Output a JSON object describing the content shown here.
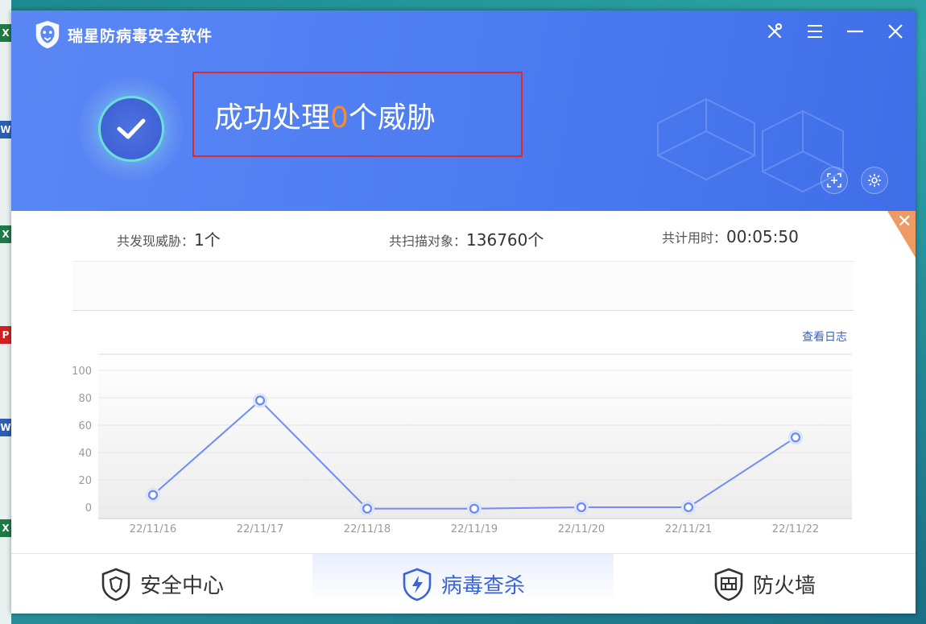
{
  "app": {
    "title": "瑞星防病毒安全软件"
  },
  "result": {
    "prefix": "成功处理",
    "count": "0",
    "suffix": "个威胁"
  },
  "stats": {
    "threats_label": "共发现威胁：",
    "threats_value": "1个",
    "objects_label": "共扫描对象：",
    "objects_value": "136760个",
    "time_label": "共计用时：",
    "time_value": "00:05:50"
  },
  "log_link": "查看日志",
  "tabs": [
    {
      "label": "安全中心",
      "icon": "shield-lion-icon",
      "active": false
    },
    {
      "label": "病毒查杀",
      "icon": "shield-bolt-icon",
      "active": true
    },
    {
      "label": "防火墙",
      "icon": "shield-firewall-icon",
      "active": false
    }
  ],
  "colors": {
    "header": "#4f7ef2",
    "accent_orange": "#ff8a1f",
    "line": "#6f8ef3",
    "active_tab": "#3b63d8",
    "frame_red": "#e0282b"
  },
  "chart_data": {
    "type": "line",
    "categories": [
      "22/11/16",
      "22/11/17",
      "22/11/18",
      "22/11/19",
      "22/11/20",
      "22/11/21",
      "22/11/22"
    ],
    "series": [
      {
        "values": [
          9,
          78,
          -1,
          -1,
          0,
          0,
          51
        ]
      }
    ],
    "yticks": [
      "100",
      "80",
      "60",
      "40",
      "20",
      "0"
    ],
    "ylim": [
      0,
      100
    ],
    "grid": true
  }
}
